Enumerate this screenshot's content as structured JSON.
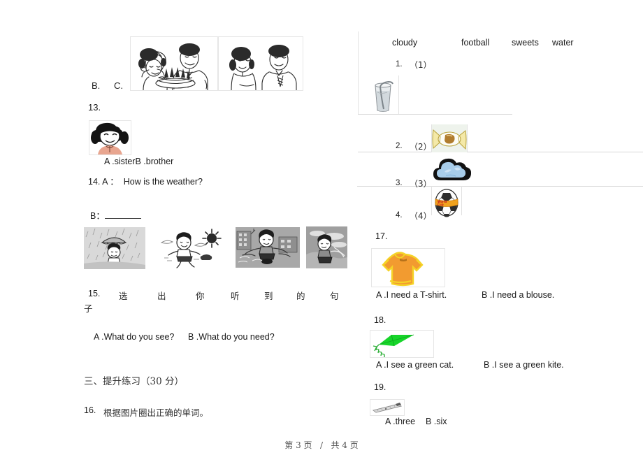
{
  "document": {
    "page_label": "第 3 页",
    "page_separator": "/",
    "page_total": "共 4 页"
  },
  "left_column": {
    "top_choices": {
      "label_b": "B.",
      "label_c": "C."
    },
    "q13": {
      "number": "13.",
      "options": "A .sisterB .brother",
      "image_alt": "girl-face-drawing"
    },
    "q14": {
      "number_and_prompt": "14. A ：  How is the weather?",
      "answer_label": "B：",
      "images": [
        "rainy-child-umbrella",
        "sunny-girl-running",
        "windy-girl-city",
        "cloudy-girl-field"
      ]
    },
    "q15": {
      "number": "15.",
      "prompt_chars": [
        "选",
        "出",
        "你",
        "听",
        "到",
        "的",
        "句"
      ],
      "prompt_wrap": "子",
      "option_a": "A .What do you see?",
      "option_b": "B .What do you need?"
    },
    "section3": {
      "heading": "三、提升练习（30 分）",
      "q16_number": "16.",
      "q16_prompt": "根据图片圈出正确的单词。"
    }
  },
  "right_column": {
    "wordbank": [
      "cloudy",
      "football",
      "sweets",
      "water"
    ],
    "items": [
      {
        "num": "1.",
        "paren": "（1）",
        "image_alt": "glass-of-water"
      },
      {
        "num": "2.",
        "paren": "（2）",
        "image_alt": "wrapped-candy"
      },
      {
        "num": "3.",
        "paren": "（3）",
        "image_alt": "blue-cloud"
      },
      {
        "num": "4.",
        "paren": "（4）",
        "image_alt": "soccer-ball"
      }
    ],
    "q17": {
      "number": "17.",
      "image_alt": "orange-t-shirt",
      "option_a": "A .I need a T-shirt.",
      "option_b": "B .I need a blouse."
    },
    "q18": {
      "number": "18.",
      "image_alt": "green-kite",
      "option_a": "A .I see a green cat.",
      "option_b": "B .I see a green kite."
    },
    "q19": {
      "number": "19.",
      "image_alt": "ruler",
      "option_a": "A .three",
      "option_b": "B .six"
    }
  },
  "colors": {
    "shirt_orange": "#f29b30",
    "shirt_trim": "#f5d327",
    "kite_green": "#17d52a",
    "cloud_blue": "#a8cdea",
    "candy_yellow": "#f2e4a8",
    "ball_band": "#f0a21e",
    "girl_top": "#e8a58f",
    "rule_gray": "#d8d8d8"
  }
}
